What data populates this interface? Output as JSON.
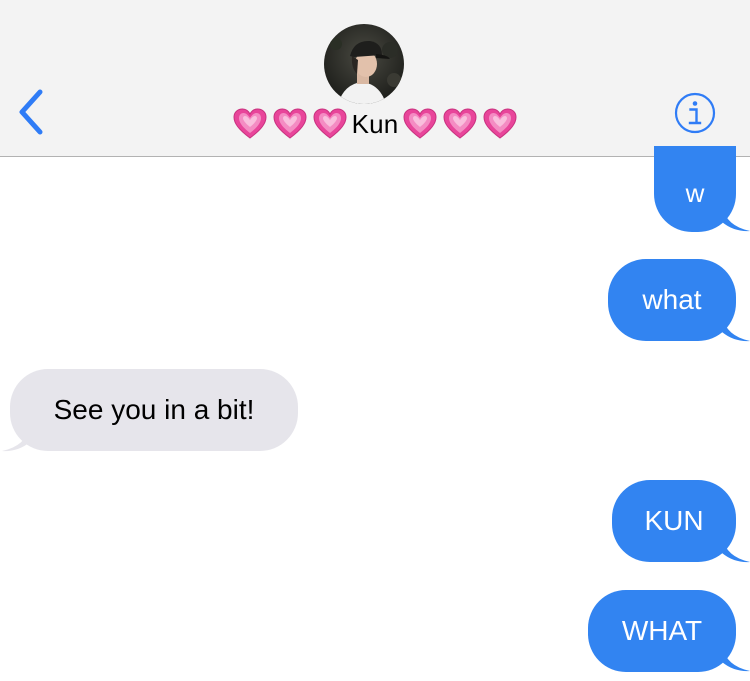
{
  "header": {
    "contact_name": "Kun",
    "hearts_left": [
      "pink-heart",
      "pink-heart",
      "pink-heart"
    ],
    "hearts_right": [
      "pink-heart",
      "pink-heart",
      "pink-heart"
    ],
    "back_icon": "chevron-left-icon",
    "info_icon": "info-icon"
  },
  "messages": [
    {
      "text": "w",
      "direction": "sent"
    },
    {
      "text": "what",
      "direction": "sent"
    },
    {
      "text": "See you in a bit!",
      "direction": "received"
    },
    {
      "text": "KUN",
      "direction": "sent"
    },
    {
      "text": "WHAT",
      "direction": "sent"
    }
  ],
  "colors": {
    "sent_bubble": "#3284f1",
    "received_bubble": "#e6e5eb",
    "accent": "#2f7cf6",
    "header_bg": "#f3f3f3",
    "heart": "#e8459a"
  }
}
